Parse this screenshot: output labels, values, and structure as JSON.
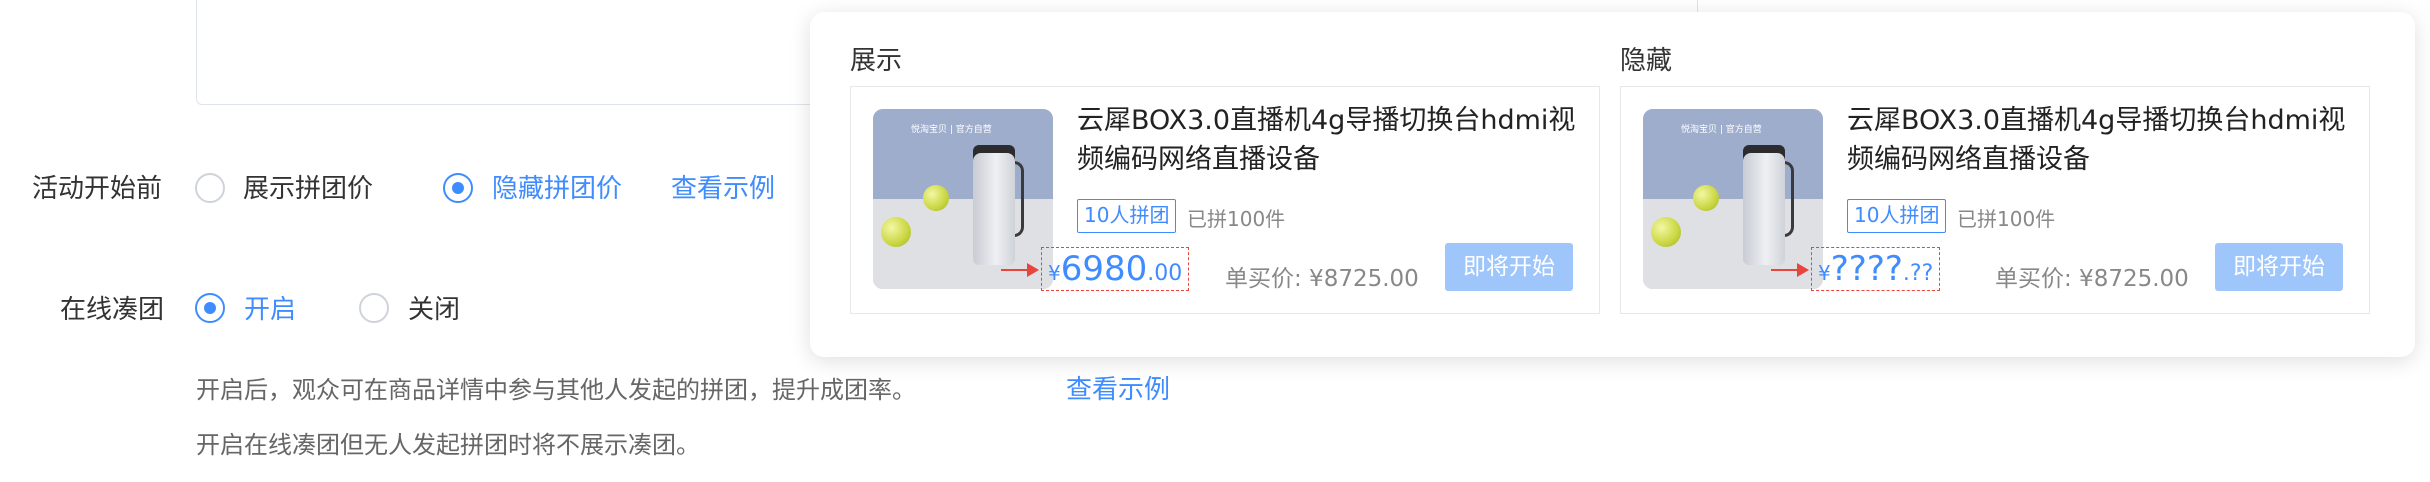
{
  "form": {
    "before_start": {
      "label": "活动开始前",
      "options": [
        {
          "label": "展示拼团价",
          "selected": false
        },
        {
          "label": "隐藏拼团价",
          "selected": true
        }
      ],
      "example_link": "查看示例"
    },
    "online_group": {
      "label": "在线凑团",
      "options": [
        {
          "label": "开启",
          "selected": true
        },
        {
          "label": "关闭",
          "selected": false
        }
      ],
      "hint1": "开启后，观众可在商品详情中参与其他人发起的拼团，提升成团率。",
      "example_link": "查看示例",
      "hint2": "开启在线凑团但无人发起拼团时将不展示凑团。"
    }
  },
  "popover": {
    "columns": [
      {
        "title": "展示",
        "card": {
          "product_title": "云犀BOX3.0直播机4g导播切换台hdmi视频编码网络直播设备",
          "group_tag": "10人拼团",
          "joined": "已拼100件",
          "price_yen": "¥",
          "price_main": "6980",
          "price_decimal": ".00",
          "single_price": "单买价: ¥8725.00",
          "button": "即将开始",
          "thumb_banner": "悦淘宝贝 | 官方自营"
        }
      },
      {
        "title": "隐藏",
        "card": {
          "product_title": "云犀BOX3.0直播机4g导播切换台hdmi视频编码网络直播设备",
          "group_tag": "10人拼团",
          "joined": "已拼100件",
          "price_yen": "¥",
          "price_main": "????",
          "price_decimal": ".??",
          "single_price": "单买价: ¥8725.00",
          "button": "即将开始",
          "thumb_banner": "悦淘宝贝 | 官方自营"
        }
      }
    ]
  },
  "colors": {
    "primary": "#3f8cff",
    "button_disabled": "#9fc6fb",
    "highlight_red": "#e8453c"
  }
}
